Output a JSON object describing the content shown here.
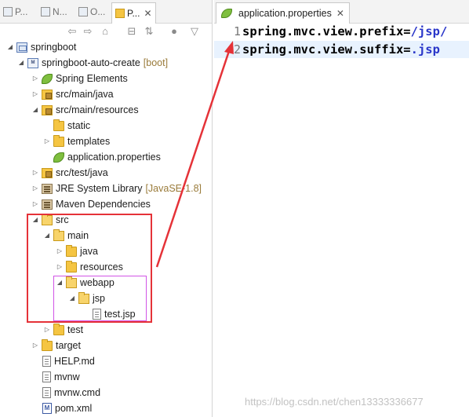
{
  "view_tabs": [
    {
      "label": "P..."
    },
    {
      "label": "N..."
    },
    {
      "label": "O..."
    },
    {
      "label": "P..."
    }
  ],
  "tree": {
    "root": {
      "label": "springboot"
    },
    "project": {
      "label": "springboot-auto-create",
      "decoration": "[boot]"
    },
    "spring_elements": {
      "label": "Spring Elements"
    },
    "src_main_java": {
      "label": "src/main/java"
    },
    "src_main_resources": {
      "label": "src/main/resources"
    },
    "static": {
      "label": "static"
    },
    "templates": {
      "label": "templates"
    },
    "application_properties": {
      "label": "application.properties"
    },
    "src_test_java": {
      "label": "src/test/java"
    },
    "jre": {
      "label": "JRE System Library",
      "decoration": "[JavaSE-1.8]"
    },
    "maven": {
      "label": "Maven Dependencies"
    },
    "src": {
      "label": "src"
    },
    "main": {
      "label": "main"
    },
    "java": {
      "label": "java"
    },
    "resources": {
      "label": "resources"
    },
    "webapp": {
      "label": "webapp"
    },
    "jsp": {
      "label": "jsp"
    },
    "test_jsp": {
      "label": "test.jsp"
    },
    "test": {
      "label": "test"
    },
    "target": {
      "label": "target"
    },
    "help_md": {
      "label": "HELP.md"
    },
    "mvnw": {
      "label": "mvnw"
    },
    "mvnw_cmd": {
      "label": "mvnw.cmd"
    },
    "pom_xml": {
      "label": "pom.xml"
    }
  },
  "editor": {
    "tab_title": "application.properties",
    "lines": [
      {
        "number": "1",
        "key": "spring.mvc.view.prefix=",
        "value": "/jsp/"
      },
      {
        "number": "2",
        "key": "spring.mvc.view.suffix=",
        "value": ".jsp"
      }
    ]
  },
  "annotation_colors": {
    "highlight_box": "#e53238",
    "inner_box": "#d154e6",
    "arrow": "#e53238"
  },
  "watermark": "https://blog.csdn.net/chen13333336677"
}
